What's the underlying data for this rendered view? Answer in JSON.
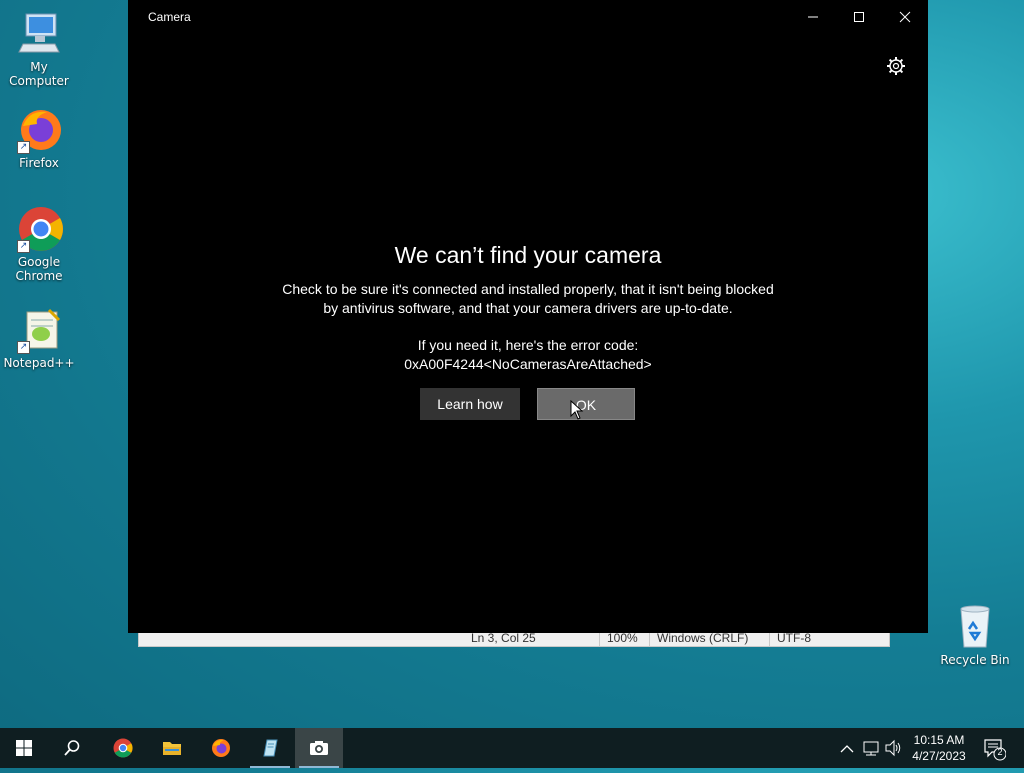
{
  "desktop": {
    "icons": [
      {
        "label": "My Computer"
      },
      {
        "label": "Firefox"
      },
      {
        "label": "Google Chrome"
      },
      {
        "label": "Notepad++"
      },
      {
        "label": "Recycle Bin"
      }
    ]
  },
  "notepad_status": {
    "position": "Ln 3, Col 25",
    "zoom": "100%",
    "line_ending": "Windows (CRLF)",
    "encoding": "UTF-8"
  },
  "camera": {
    "title": "Camera",
    "headline": "We can’t find your camera",
    "body_line1": "Check to be sure it's connected and installed properly, that it isn't being blocked",
    "body_line2": "by antivirus software, and that your camera drivers are up-to-date.",
    "error_intro": "If you need it, here's the error code:",
    "error_code": "0xA00F4244<NoCamerasAreAttached>",
    "learn_label": "Learn how",
    "ok_label": "OK"
  },
  "taskbar": {
    "time": "10:15 AM",
    "date": "4/27/2023",
    "notification_count": "2"
  },
  "colors": {
    "taskbar": "#0f1e21",
    "window_bg": "#000000",
    "ok_button": "#6a6a6a",
    "learn_button": "#333333"
  }
}
